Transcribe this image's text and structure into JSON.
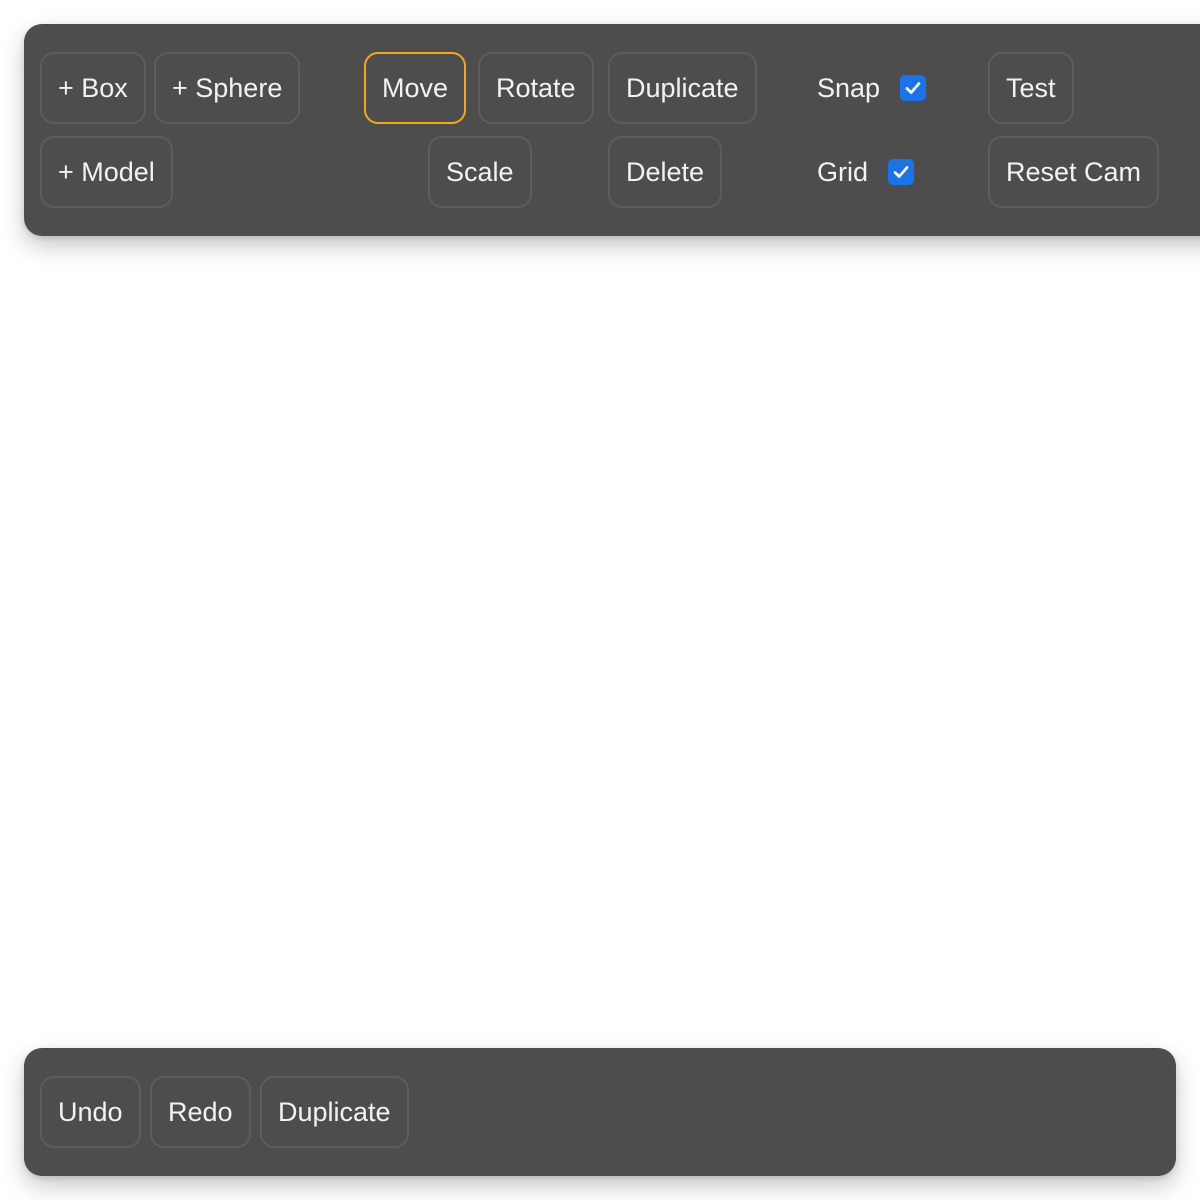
{
  "top_toolbar": {
    "row1": {
      "add_box": "+ Box",
      "add_sphere": "+ Sphere",
      "move": "Move",
      "rotate": "Rotate",
      "duplicate": "Duplicate",
      "snap_label": "Snap",
      "snap_checked": true,
      "test": "Test"
    },
    "row2": {
      "add_model": "+ Model",
      "scale": "Scale",
      "delete": "Delete",
      "grid_label": "Grid",
      "grid_checked": true,
      "reset_cam": "Reset Cam"
    },
    "active_tool": "Move"
  },
  "bottom_toolbar": {
    "undo": "Undo",
    "redo": "Redo",
    "duplicate": "Duplicate"
  },
  "colors": {
    "panel": "#4d4d4d",
    "button_border": "#5c5c5c",
    "active_border": "#f2a81d",
    "checkbox": "#1a73e8",
    "text": "#f2f2f2"
  },
  "icons": {
    "checkbox_mark": "checkmark-icon"
  }
}
